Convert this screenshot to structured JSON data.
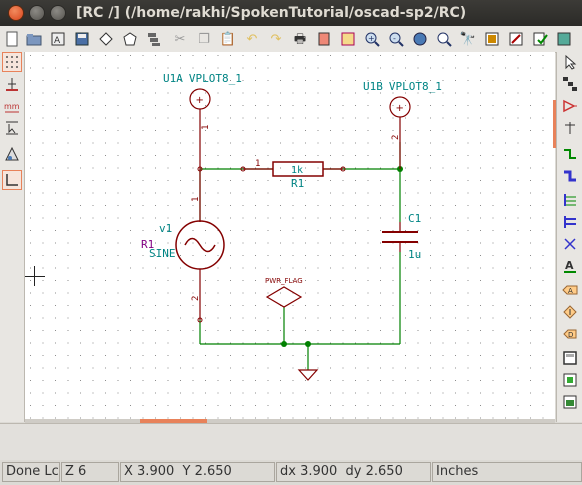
{
  "window": {
    "title": "[RC /] (/home/rakhi/SpokenTutorial/oscad-sp2/RC)",
    "controls": [
      "close-icon",
      "minimize-icon",
      "maximize-icon"
    ]
  },
  "toolbar": {
    "icons": [
      "new-sheet-icon",
      "open-icon",
      "annotate-icon",
      "save-icon",
      "page-settings-icon",
      "hierarchy-navigator-icon",
      "cut-icon",
      "copy-icon",
      "paste-icon",
      "undo-icon",
      "redo-icon",
      "print-icon",
      "netlist-icon",
      "bom-icon",
      "zoom-in-icon",
      "zoom-out-icon",
      "zoom-redraw-icon",
      "zoom-fit-icon",
      "find-icon",
      "library-browser-icon",
      "footprint-editor-icon",
      "erc-icon",
      "pcb-icon"
    ]
  },
  "left_toolbar": {
    "icons": [
      "grid-toggle-icon",
      "units-inches-icon",
      "units-mm-icon",
      "cursor-shape-icon",
      "hidden-pins-icon",
      "orthogonal-wire-icon"
    ]
  },
  "right_toolbar": {
    "icons": [
      "select-arrow-icon",
      "hierarchy-icon",
      "add-component-icon",
      "add-power-icon",
      "add-wire-icon",
      "add-bus-icon",
      "wire-to-bus-icon",
      "bus-to-bus-icon",
      "no-connect-icon",
      "net-label-icon",
      "global-label-icon",
      "junction-icon",
      "hierarchical-label-icon",
      "hierarchical-sheet-icon",
      "import-pin-icon",
      "sheet-pin-icon",
      "add-text-icon",
      "add-image-icon"
    ]
  },
  "schematic": {
    "components": [
      {
        "ref": "U1A",
        "value": "VPLOT8_1",
        "pin": "1"
      },
      {
        "ref": "U1B",
        "value": "VPLOT8_1",
        "pin": "2"
      },
      {
        "ref": "R1",
        "value": "1k",
        "pin": "1"
      },
      {
        "ref": "C1",
        "value": "1u"
      },
      {
        "ref": "v1",
        "value": "SINE",
        "extra_label": "R1",
        "pin_top": "1",
        "pin_bottom": "2"
      },
      {
        "ref": "PWR_FLAG"
      }
    ],
    "pin_labels": {
      "u1a": "1",
      "u1b": "2",
      "r1_left": "1",
      "v1_top": "1",
      "v1_bottom": "2"
    },
    "colors": {
      "wire": "#008000",
      "symbol": "#840000",
      "reference": "#008484",
      "grid": "#8c8c8c",
      "pin_text": "#840000",
      "extra_ref": "#840084"
    }
  },
  "status": {
    "message": "Done Lc",
    "zoom": "Z 6",
    "coords": "X 3.900  Y 2.650",
    "delta": "dx 3.900  dy 2.650",
    "units": "Inches"
  }
}
